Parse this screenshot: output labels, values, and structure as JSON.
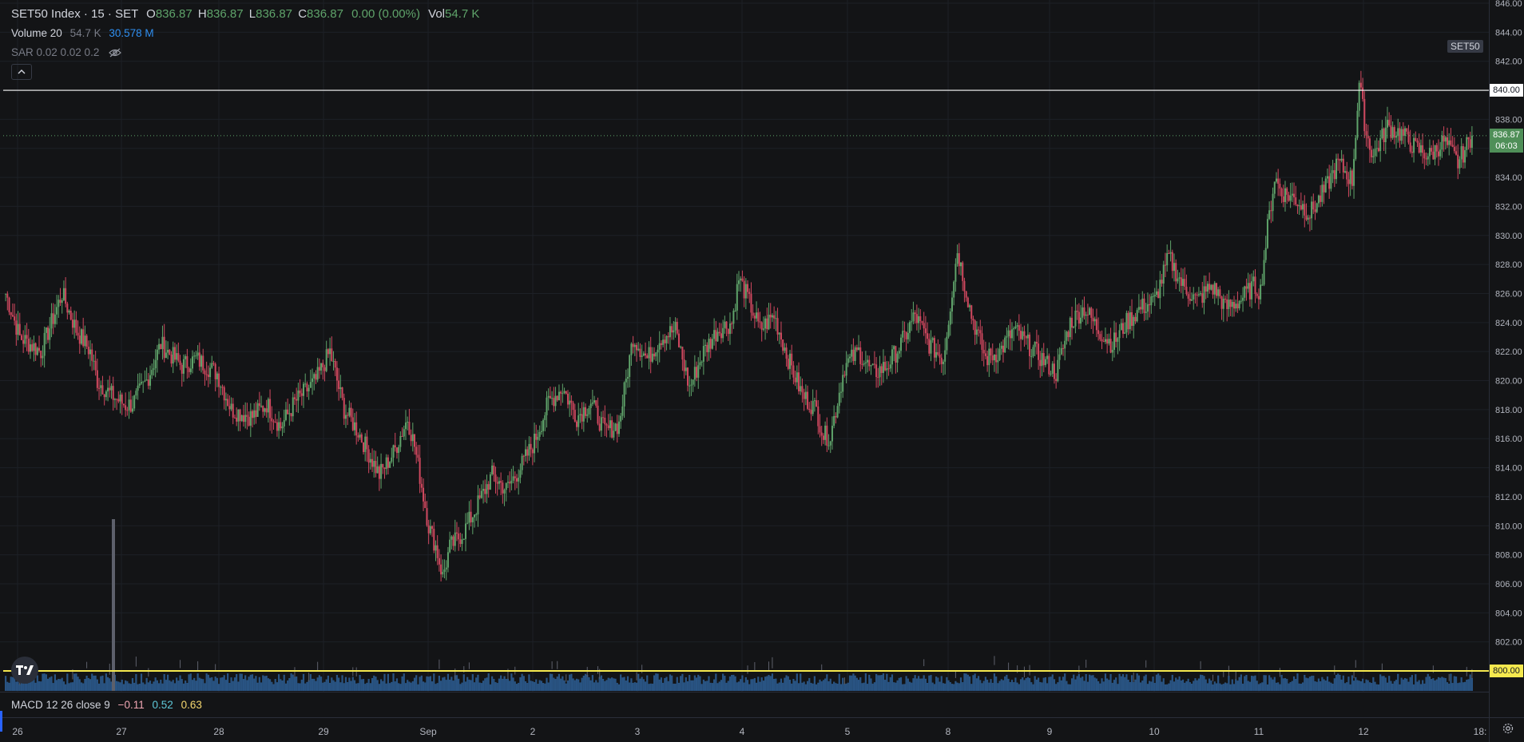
{
  "header": {
    "symbol": "SET50 Index · 15 · SET",
    "open_label": "O",
    "open": "836.87",
    "high_label": "H",
    "high": "836.87",
    "low_label": "L",
    "low": "836.87",
    "close_label": "C",
    "close": "836.87",
    "change": "0.00 (0.00%)",
    "vol_label": "Vol",
    "vol": "54.7 K"
  },
  "volume_legend": {
    "label": "Volume 20",
    "value": "54.7 K",
    "ma": "30.578 M"
  },
  "sar_legend": {
    "label": "SAR 0.02 0.02 0.2"
  },
  "macd_legend": {
    "label": "MACD 12 26 close 9",
    "macd": "−0.11",
    "signal": "0.52",
    "hist": "0.63"
  },
  "symbol_tag": "SET50",
  "price_tags": {
    "line_840": "840.00",
    "last": "836.87",
    "countdown": "06:03",
    "line_800": "800.00"
  },
  "colors": {
    "up": "#5fa36a",
    "down": "#d0485f",
    "volume": "#2e5f96",
    "line_840": "#ffffff",
    "line_800": "#f5e94e",
    "background": "#131416"
  },
  "icons": [
    "chevron-up-icon",
    "eye-off-icon",
    "tradingview-logo",
    "gear-icon"
  ],
  "chart_data": {
    "type": "candlestick",
    "ylim": [
      800,
      846
    ],
    "y_ticks": [
      "846.00",
      "844.00",
      "842.00",
      "840.00",
      "838.00",
      "836.00",
      "834.00",
      "832.00",
      "830.00",
      "828.00",
      "826.00",
      "824.00",
      "822.00",
      "820.00",
      "818.00",
      "816.00",
      "814.00",
      "812.00",
      "810.00",
      "808.00",
      "806.00",
      "804.00",
      "802.00",
      "800.00"
    ],
    "x_ticks": [
      "26",
      "27",
      "28",
      "29",
      "Sep",
      "2",
      "3",
      "4",
      "5",
      "8",
      "9",
      "10",
      "11",
      "12",
      "18:"
    ],
    "horizontal_lines": [
      840,
      800
    ],
    "last_price": 836.87,
    "close_path": [
      [
        0,
        826
      ],
      [
        2,
        823
      ],
      [
        5,
        822
      ],
      [
        8,
        826
      ],
      [
        10,
        823.5
      ],
      [
        12,
        822
      ],
      [
        13,
        820
      ],
      [
        15,
        819
      ],
      [
        17,
        818.3
      ],
      [
        18,
        818.4
      ],
      [
        20,
        820
      ],
      [
        22,
        822.5
      ],
      [
        25,
        821
      ],
      [
        27,
        821.5
      ],
      [
        30,
        820.5
      ],
      [
        32,
        818
      ],
      [
        35,
        817.5
      ],
      [
        37,
        818.4
      ],
      [
        39,
        816.8
      ],
      [
        41,
        818.5
      ],
      [
        44,
        820
      ],
      [
        46,
        822
      ],
      [
        48,
        818
      ],
      [
        50,
        816.5
      ],
      [
        52,
        814.5
      ],
      [
        53,
        813.5
      ],
      [
        55,
        815
      ],
      [
        57,
        817.4
      ],
      [
        58,
        815.5
      ],
      [
        60,
        810
      ],
      [
        61,
        808.6
      ],
      [
        62,
        806.5
      ],
      [
        63,
        808.5
      ],
      [
        65,
        809.6
      ],
      [
        67,
        811.5
      ],
      [
        69,
        813.5
      ],
      [
        71,
        812.5
      ],
      [
        73,
        814
      ],
      [
        75,
        815.8
      ],
      [
        77,
        818.5
      ],
      [
        79,
        819.5
      ],
      [
        81,
        817.5
      ],
      [
        83,
        818.5
      ],
      [
        85,
        816.5
      ],
      [
        87,
        817
      ],
      [
        89,
        823
      ],
      [
        91,
        821.5
      ],
      [
        93,
        823
      ],
      [
        95,
        823.5
      ],
      [
        97,
        819.5
      ],
      [
        99,
        822
      ],
      [
        101,
        823.5
      ],
      [
        103,
        824
      ],
      [
        104,
        827
      ],
      [
        105,
        826
      ],
      [
        107,
        823.5
      ],
      [
        109,
        824.5
      ],
      [
        111,
        821.5
      ],
      [
        113,
        819
      ],
      [
        115,
        818
      ],
      [
        116,
        816.2
      ],
      [
        117,
        816.2
      ],
      [
        119,
        821
      ],
      [
        121,
        822
      ],
      [
        123,
        820.5
      ],
      [
        125,
        821
      ],
      [
        127,
        822.5
      ],
      [
        129,
        824.5
      ],
      [
        131,
        822.5
      ],
      [
        133,
        821.5
      ],
      [
        135,
        829
      ],
      [
        137,
        824.5
      ],
      [
        139,
        821.5
      ],
      [
        141,
        822
      ],
      [
        143,
        823.5
      ],
      [
        145,
        822.5
      ],
      [
        147,
        821.5
      ],
      [
        149,
        820.5
      ],
      [
        151,
        824
      ],
      [
        153,
        825
      ],
      [
        155,
        823.5
      ],
      [
        157,
        822.5
      ],
      [
        159,
        824
      ],
      [
        161,
        825
      ],
      [
        163,
        825.5
      ],
      [
        165,
        828.5
      ],
      [
        167,
        826.5
      ],
      [
        169,
        825.5
      ],
      [
        171,
        826.5
      ],
      [
        172,
        826
      ],
      [
        173,
        825
      ],
      [
        175,
        825.5
      ],
      [
        177,
        826.5
      ],
      [
        178,
        826.2
      ],
      [
        179,
        830.5
      ],
      [
        180,
        834
      ],
      [
        181,
        833
      ],
      [
        183,
        832.5
      ],
      [
        185,
        831.5
      ],
      [
        187,
        833
      ],
      [
        189,
        835
      ],
      [
        191,
        833.8
      ],
      [
        192,
        840.5
      ],
      [
        193,
        837
      ],
      [
        194,
        835.5
      ],
      [
        196,
        837.5
      ],
      [
        198,
        837
      ],
      [
        200,
        836
      ],
      [
        202,
        835.5
      ],
      [
        204,
        836.5
      ],
      [
        206,
        835
      ],
      [
        208,
        836.87
      ]
    ]
  }
}
